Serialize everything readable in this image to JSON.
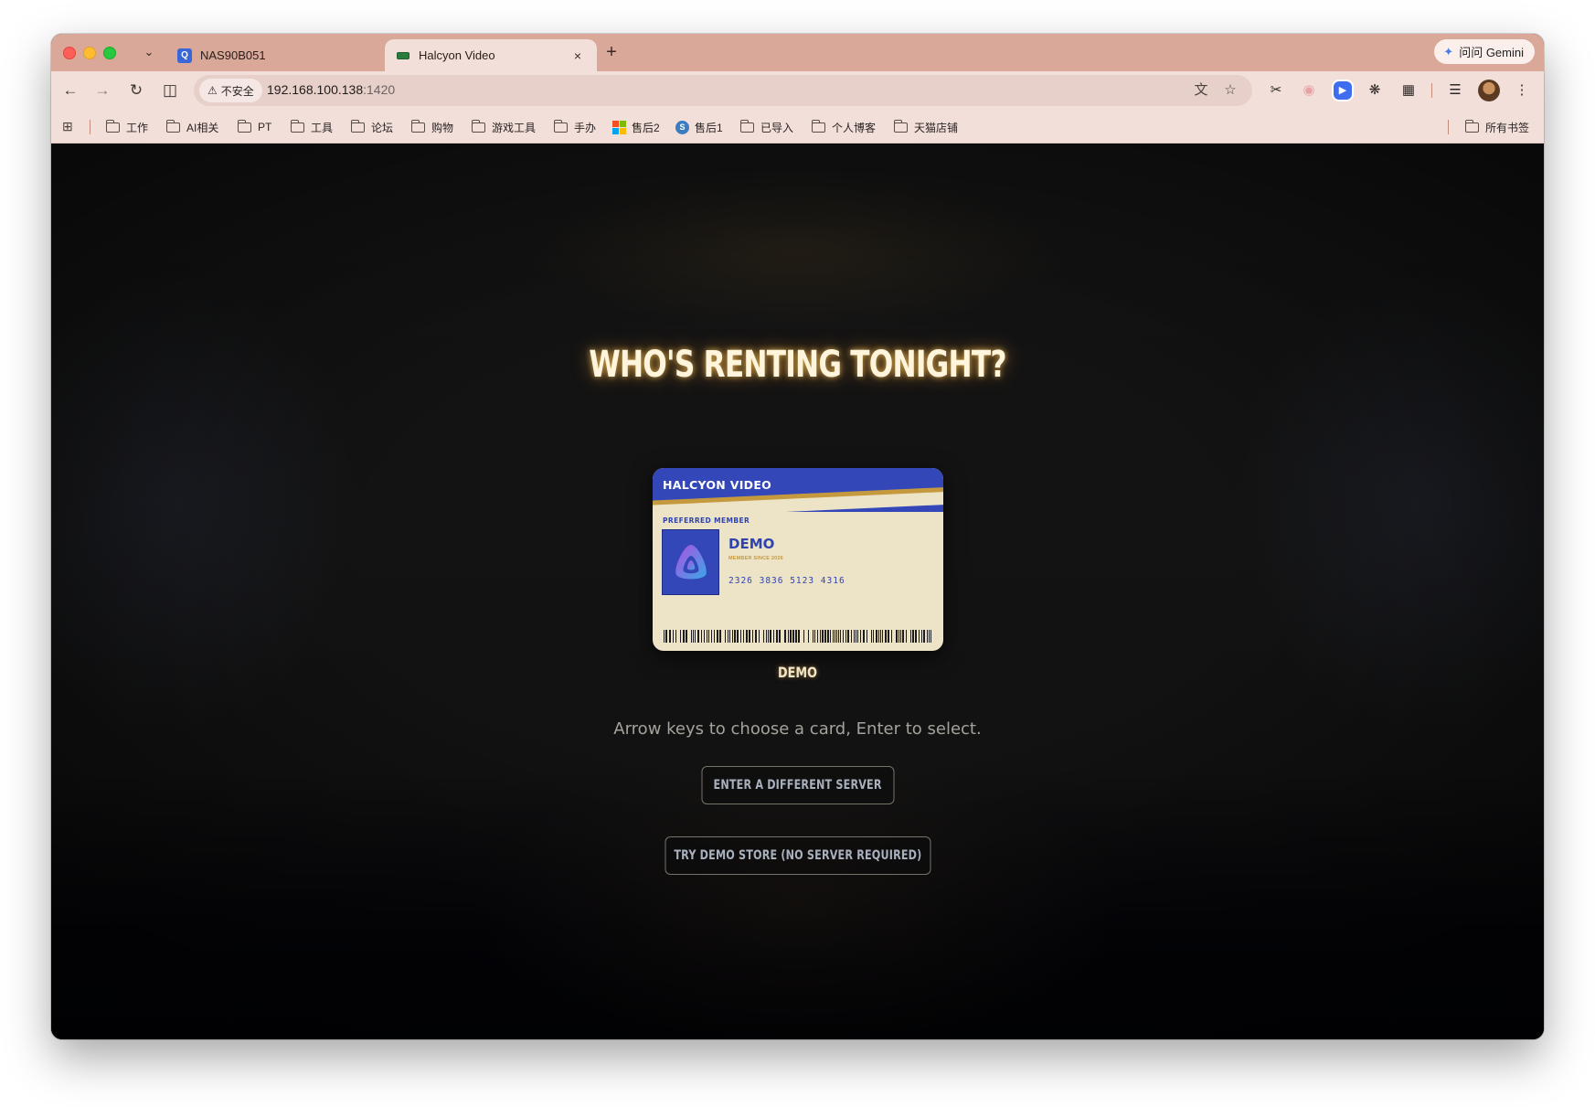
{
  "browser": {
    "tabs": [
      {
        "title": "NAS90B051",
        "favicon": "nas-icon",
        "active": false
      },
      {
        "title": "Halcyon Video",
        "favicon": "halcyon-icon",
        "active": true
      }
    ],
    "new_tab_symbol": "+",
    "close_symbol": "×",
    "gemini_label": "问问 Gemini",
    "security_label": "不安全",
    "url_host": "192.168.100.138",
    "url_port": ":1420",
    "colors": {
      "tabstrip": "#d9a899",
      "toolbar": "#f2dfd9"
    }
  },
  "bookmarks": {
    "items": [
      {
        "label": "工作",
        "icon": "folder-icon"
      },
      {
        "label": "AI相关",
        "icon": "folder-icon"
      },
      {
        "label": "PT",
        "icon": "folder-icon"
      },
      {
        "label": "工具",
        "icon": "folder-icon"
      },
      {
        "label": "论坛",
        "icon": "folder-icon"
      },
      {
        "label": "购物",
        "icon": "folder-icon"
      },
      {
        "label": "游戏工具",
        "icon": "folder-icon"
      },
      {
        "label": "手办",
        "icon": "folder-icon"
      },
      {
        "label": "售后2",
        "icon": "microsoft-icon"
      },
      {
        "label": "售后1",
        "icon": "s-icon"
      },
      {
        "label": "已导入",
        "icon": "folder-icon"
      },
      {
        "label": "个人博客",
        "icon": "folder-icon"
      },
      {
        "label": "天猫店铺",
        "icon": "folder-icon"
      }
    ],
    "all_bookmarks": "所有书签"
  },
  "page": {
    "headline": "WHO'S RENTING TONIGHT?",
    "card": {
      "brand": "HALCYON VIDEO",
      "tier": "PREFERRED MEMBER",
      "name": "DEMO",
      "member_since": "MEMBER SINCE 2026",
      "number": "2326 3836 5123 4316",
      "colors": {
        "band": "#3347b9",
        "body": "#ede4c8",
        "accent": "#c59a3e"
      }
    },
    "card_label": "DEMO",
    "hint": "Arrow keys to choose a card, Enter to select.",
    "server_button": "ENTER A DIFFERENT SERVER",
    "demo_button": "TRY DEMO STORE (NO SERVER REQUIRED)"
  }
}
